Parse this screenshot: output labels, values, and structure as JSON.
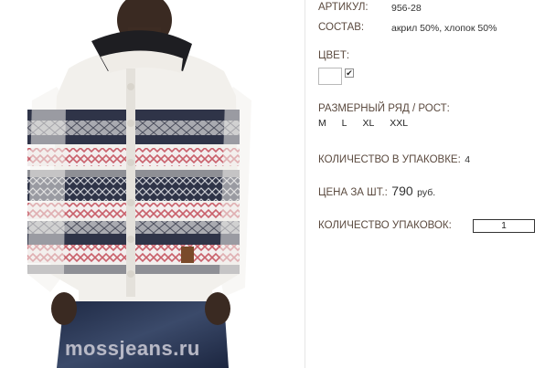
{
  "product": {
    "article_label": "АРТИКУЛ:",
    "article_value": "956-28",
    "composition_label": "СОСТАВ:",
    "composition_value": "акрил 50%, хлопок 50%",
    "color_label": "ЦВЕТ:",
    "color_checked": "✔",
    "sizes_label": "РАЗМЕРНЫЙ РЯД / РОСТ:",
    "sizes": [
      "M",
      "L",
      "XL",
      "XXL"
    ],
    "pack_qty_label": "КОЛИЧЕСТВО В УПАКОВКЕ:",
    "pack_qty_value": "4",
    "price_label": "ЦЕНА ЗА ШТ.:",
    "price_value": "790",
    "price_unit": "руб.",
    "packs_label": "КОЛИЧЕСТВО УПАКОВОК:",
    "packs_value": "1"
  },
  "photo": {
    "watermark": "mossjeans.ru"
  },
  "colors": {
    "label_text": "#5b4a3f",
    "sweater_white": "#f2f0ec",
    "stripe_navy": "#2f3448",
    "stripe_red": "#c9606b",
    "stripe_grey": "#8e8f95",
    "jeans": "#2a3550"
  }
}
